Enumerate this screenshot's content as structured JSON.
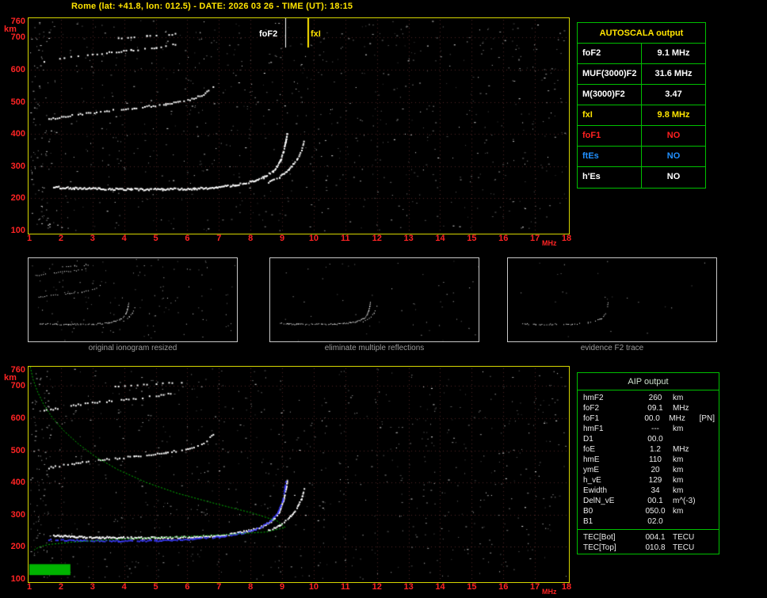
{
  "title": "Rome (lat: +41.8, lon: 012.5) - DATE: 2026 03 26 - TIME (UT): 18:15",
  "colors": {
    "background": "#000000",
    "title_text": "#ffe400",
    "axis_text": "#ff2424",
    "plot_border": "#d6d600",
    "table_border": "#00c000",
    "grid": "#4e2323",
    "trace": "#ffffff",
    "fitted_trace": "#3c3cff",
    "profile": "#00b400",
    "fof2_line": "#ffffff",
    "fxi_line": "#ffe400",
    "thumb_label": "#9a9a9a"
  },
  "autoscala_table": {
    "title": "AUTOSCALA output",
    "rows": [
      {
        "label": "foF2",
        "value": "9.1 MHz",
        "color": "#ffffff"
      },
      {
        "label": "MUF(3000)F2",
        "value": "31.6 MHz",
        "color": "#ffffff"
      },
      {
        "label": "M(3000)F2",
        "value": "3.47",
        "color": "#ffffff"
      },
      {
        "label": "fxI",
        "value": "9.8 MHz",
        "color": "#ffe400"
      },
      {
        "label": "foF1",
        "value": "NO",
        "color": "#ff2020"
      },
      {
        "label": "ftEs",
        "value": "NO",
        "color": "#2090ff"
      },
      {
        "label": "h'Es",
        "value": "NO",
        "color": "#ffffff"
      }
    ]
  },
  "aip_table": {
    "title": "AIP output",
    "rows": [
      {
        "param": "hmF2",
        "value": "260",
        "unit": "km",
        "note": ""
      },
      {
        "param": "foF2",
        "value": "09.1",
        "unit": "MHz",
        "note": ""
      },
      {
        "param": "foF1",
        "value": "00.0",
        "unit": "MHz",
        "note": "[PN]"
      },
      {
        "param": "hmF1",
        "value": "---",
        "unit": "km",
        "note": ""
      },
      {
        "param": "D1",
        "value": "00.0",
        "unit": "",
        "note": ""
      },
      {
        "param": "foE",
        "value": "1.2",
        "unit": "MHz",
        "note": ""
      },
      {
        "param": "hmE",
        "value": "110",
        "unit": "km",
        "note": ""
      },
      {
        "param": "ymE",
        "value": "20",
        "unit": "km",
        "note": ""
      },
      {
        "param": "h_vE",
        "value": "129",
        "unit": "km",
        "note": ""
      },
      {
        "param": "Ewidth",
        "value": "34",
        "unit": "km",
        "note": ""
      },
      {
        "param": "DelN_vE",
        "value": "00.1",
        "unit": "m^(-3)",
        "note": ""
      },
      {
        "param": "B0",
        "value": "050.0",
        "unit": "km",
        "note": ""
      },
      {
        "param": "B1",
        "value": "02.0",
        "unit": "",
        "note": ""
      }
    ],
    "tec_rows": [
      {
        "param": "TEC[Bot]",
        "value": "004.1",
        "unit": "TECU"
      },
      {
        "param": "TEC[Top]",
        "value": "010.8",
        "unit": "TECU"
      }
    ]
  },
  "thumbnails": [
    {
      "label": "original ionogram resized",
      "traces": [
        "F2-trace",
        "F2-x-trace",
        "second-reflection",
        "third-reflection",
        "fourth-reflection"
      ],
      "noise": 130,
      "gap": 0.12
    },
    {
      "label": "eliminate multiple reflections",
      "traces": [
        "F2-trace",
        "F2-x-trace"
      ],
      "noise": 50,
      "gap": 0.15
    },
    {
      "label": "evidence F2 trace",
      "traces": [
        "F2-trace"
      ],
      "noise": 22,
      "gap": 0.5
    }
  ],
  "chart_data": [
    {
      "id": "main-ionogram",
      "type": "scatter",
      "xlabel": "MHz",
      "ylabel": "km",
      "xlim": [
        1,
        18
      ],
      "ylim": [
        100,
        760
      ],
      "grid": true,
      "x_ticks": [
        1,
        2,
        3,
        4,
        5,
        6,
        7,
        8,
        9,
        10,
        11,
        12,
        13,
        14,
        15,
        16,
        17,
        18
      ],
      "y_ticks": [
        760,
        700,
        600,
        500,
        400,
        300,
        200,
        100
      ],
      "markers": {
        "foF2_MHz": 9.1,
        "fxI_MHz": 9.8
      },
      "marker_labels": {
        "foF2": "foF2",
        "fxI": "fxI"
      },
      "traces": [
        {
          "name": "F2-trace",
          "points": [
            [
              1.75,
              237
            ],
            [
              2.4,
              233
            ],
            [
              3.2,
              231
            ],
            [
              4.2,
              230
            ],
            [
              5.2,
              230
            ],
            [
              6.2,
              232
            ],
            [
              6.9,
              236
            ],
            [
              7.5,
              243
            ],
            [
              8.0,
              253
            ],
            [
              8.4,
              267
            ],
            [
              8.7,
              286
            ],
            [
              8.9,
              312
            ],
            [
              9.02,
              345
            ],
            [
              9.1,
              380
            ],
            [
              9.14,
              405
            ]
          ]
        },
        {
          "name": "F2-x-trace",
          "points": [
            [
              8.55,
              252
            ],
            [
              8.9,
              268
            ],
            [
              9.2,
              292
            ],
            [
              9.45,
              322
            ],
            [
              9.6,
              352
            ],
            [
              9.68,
              382
            ]
          ]
        },
        {
          "name": "second-reflection",
          "points": [
            [
              1.6,
              448
            ],
            [
              2.4,
              461
            ],
            [
              3.3,
              472
            ],
            [
              4.3,
              483
            ],
            [
              5.3,
              494
            ],
            [
              6.0,
              507
            ],
            [
              6.5,
              524
            ],
            [
              6.8,
              550
            ]
          ]
        },
        {
          "name": "third-reflection",
          "points": [
            [
              1.45,
              625
            ],
            [
              2.3,
              641
            ],
            [
              3.2,
              652
            ],
            [
              4.2,
              662
            ],
            [
              5.0,
              671
            ],
            [
              5.6,
              681
            ]
          ]
        },
        {
          "name": "fourth-reflection",
          "points": [
            [
              3.7,
              700
            ],
            [
              4.7,
              707
            ],
            [
              5.8,
              714
            ]
          ]
        }
      ]
    },
    {
      "id": "profile-ionogram",
      "type": "scatter",
      "xlabel": "MHz",
      "ylabel": "km",
      "xlim": [
        1,
        18
      ],
      "ylim": [
        100,
        760
      ],
      "grid": true,
      "x_ticks": [
        1,
        2,
        3,
        4,
        5,
        6,
        7,
        8,
        9,
        10,
        11,
        12,
        13,
        14,
        15,
        16,
        17,
        18
      ],
      "y_ticks": [
        760,
        700,
        600,
        500,
        400,
        300,
        200,
        100
      ],
      "traces": [
        {
          "name": "F2-trace",
          "points": [
            [
              1.75,
              237
            ],
            [
              2.4,
              233
            ],
            [
              3.2,
              231
            ],
            [
              4.2,
              230
            ],
            [
              5.2,
              230
            ],
            [
              6.2,
              232
            ],
            [
              6.9,
              236
            ],
            [
              7.5,
              243
            ],
            [
              8.0,
              253
            ],
            [
              8.4,
              267
            ],
            [
              8.7,
              286
            ],
            [
              8.9,
              312
            ],
            [
              9.02,
              345
            ],
            [
              9.1,
              380
            ],
            [
              9.14,
              405
            ]
          ]
        },
        {
          "name": "F2-x-trace",
          "points": [
            [
              8.55,
              252
            ],
            [
              8.9,
              268
            ],
            [
              9.2,
              292
            ],
            [
              9.45,
              322
            ],
            [
              9.6,
              352
            ],
            [
              9.68,
              382
            ]
          ]
        },
        {
          "name": "second-reflection",
          "points": [
            [
              1.6,
              448
            ],
            [
              2.4,
              461
            ],
            [
              3.3,
              472
            ],
            [
              4.3,
              483
            ],
            [
              5.3,
              494
            ],
            [
              6.0,
              507
            ],
            [
              6.5,
              524
            ],
            [
              6.8,
              550
            ]
          ]
        },
        {
          "name": "third-reflection",
          "points": [
            [
              1.45,
              625
            ],
            [
              2.3,
              641
            ],
            [
              3.2,
              652
            ],
            [
              4.2,
              662
            ],
            [
              5.0,
              671
            ],
            [
              5.6,
              681
            ]
          ]
        },
        {
          "name": "fourth-reflection",
          "points": [
            [
              3.7,
              700
            ],
            [
              4.7,
              707
            ],
            [
              5.8,
              714
            ]
          ]
        }
      ],
      "fitted_trace": [
        [
          1.6,
          224
        ],
        [
          2.6,
          221
        ],
        [
          3.8,
          220
        ],
        [
          5.0,
          221
        ],
        [
          6.2,
          226
        ],
        [
          7.0,
          233
        ],
        [
          7.7,
          244
        ],
        [
          8.2,
          258
        ],
        [
          8.6,
          280
        ],
        [
          8.85,
          310
        ],
        [
          9.0,
          348
        ],
        [
          9.07,
          385
        ],
        [
          9.1,
          405
        ]
      ],
      "profile": [
        [
          1.03,
          760
        ],
        [
          1.12,
          720
        ],
        [
          1.27,
          680
        ],
        [
          1.47,
          640
        ],
        [
          1.74,
          600
        ],
        [
          2.1,
          560
        ],
        [
          2.55,
          520
        ],
        [
          3.1,
          480
        ],
        [
          3.8,
          440
        ],
        [
          4.7,
          400
        ],
        [
          5.7,
          366
        ],
        [
          6.9,
          334
        ],
        [
          8.1,
          304
        ],
        [
          8.85,
          280
        ],
        [
          9.1,
          260
        ],
        [
          8.5,
          246
        ],
        [
          7.2,
          238
        ],
        [
          5.5,
          230
        ],
        [
          3.7,
          223
        ],
        [
          2.4,
          215
        ],
        [
          1.6,
          207
        ],
        [
          1.3,
          199
        ],
        [
          1.15,
          190
        ]
      ],
      "e_layer_box": {
        "f": [
          1.0,
          2.3
        ],
        "h": [
          112,
          146
        ]
      }
    }
  ]
}
